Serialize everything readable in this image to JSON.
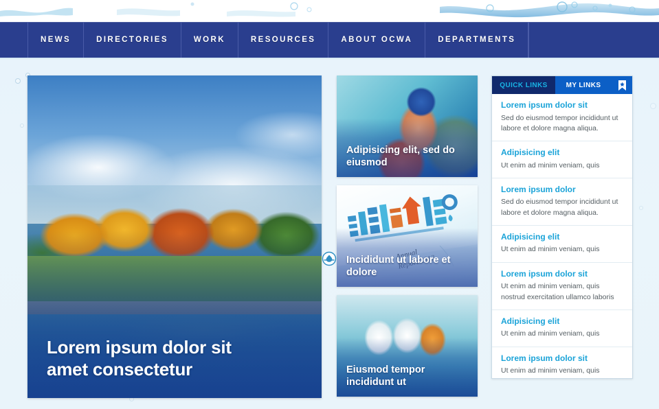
{
  "nav": {
    "items": [
      {
        "label": "NEWS"
      },
      {
        "label": "DIRECTORIES"
      },
      {
        "label": "WORK"
      },
      {
        "label": "RESOURCES"
      },
      {
        "label": "ABOUT OCWA"
      },
      {
        "label": "DEPARTMENTS"
      }
    ],
    "bar_color": "#2a3e8e",
    "divider_color": "#4a5ca8"
  },
  "hero": {
    "caption": "Lorem ipsum dolor sit amet consectetur",
    "icon": "water-drop-logo"
  },
  "cards": [
    {
      "caption": "Adipisicing elit, sed do eiusmod",
      "image": "worker-in-blue-hard-hat"
    },
    {
      "caption": "Incididunt ut labore et dolore",
      "image": "annual-report-cover",
      "cover_text_line1": "Annual",
      "cover_text_line2": "Report 2013"
    },
    {
      "caption": "Eiusmod tempor incididunt ut",
      "image": "workers-at-treatment-plant"
    }
  ],
  "panel": {
    "tabs": [
      {
        "label": "QUICK LINKS",
        "active": true
      },
      {
        "label": "MY LINKS",
        "active": false
      }
    ],
    "bookmark_icon": "bookmark-icon",
    "accent_color": "#1aa3d8",
    "tab_active_bg": "#10296c",
    "tab_inactive_bg": "#0c5fc6",
    "items": [
      {
        "title": "Lorem ipsum dolor sit",
        "desc": "Sed do eiusmod tempor incididunt ut labore et dolore magna aliqua."
      },
      {
        "title": "Adipisicing elit",
        "desc": "Ut enim ad minim veniam, quis"
      },
      {
        "title": "Lorem ipsum dolor",
        "desc": "Sed do eiusmod tempor incididunt ut labore et dolore magna aliqua."
      },
      {
        "title": "Adipisicing elit",
        "desc": "Ut enim ad minim veniam, quis"
      },
      {
        "title": "Lorem ipsum dolor sit",
        "desc": "Ut enim ad minim veniam, quis nostrud exercitation ullamco laboris"
      },
      {
        "title": "Adipisicing elit",
        "desc": "Ut enim ad minim veniam, quis"
      },
      {
        "title": "Lorem ipsum dolor sit",
        "desc": "Ut enim ad minim veniam, quis nostrud exercitation ullamco laboris"
      }
    ]
  }
}
